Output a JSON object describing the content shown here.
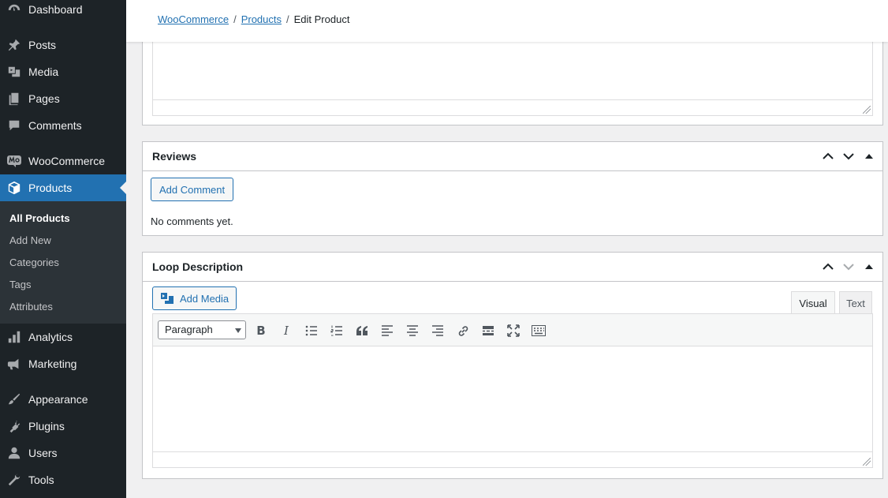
{
  "sidebar": {
    "items": [
      {
        "label": "Dashboard",
        "icon": "dashboard-icon"
      },
      {
        "label": "Posts",
        "icon": "pin-icon"
      },
      {
        "label": "Media",
        "icon": "media-icon"
      },
      {
        "label": "Pages",
        "icon": "pages-icon"
      },
      {
        "label": "Comments",
        "icon": "comments-icon"
      },
      {
        "label": "WooCommerce",
        "icon": "woocommerce-icon"
      },
      {
        "label": "Products",
        "icon": "products-box-icon"
      },
      {
        "label": "Analytics",
        "icon": "analytics-icon"
      },
      {
        "label": "Marketing",
        "icon": "megaphone-icon"
      },
      {
        "label": "Appearance",
        "icon": "paintbrush-icon"
      },
      {
        "label": "Plugins",
        "icon": "plugin-icon"
      },
      {
        "label": "Users",
        "icon": "user-icon"
      },
      {
        "label": "Tools",
        "icon": "wrench-icon"
      }
    ],
    "submenu": [
      "All Products",
      "Add New",
      "Categories",
      "Tags",
      "Attributes"
    ]
  },
  "breadcrumb": {
    "first": "WooCommerce",
    "second": "Products",
    "current": "Edit Product",
    "separator": "/"
  },
  "reviews": {
    "title": "Reviews",
    "add_button": "Add Comment",
    "empty_text": "No comments yet."
  },
  "loop_description": {
    "title": "Loop Description",
    "add_media": "Add Media",
    "tab_visual": "Visual",
    "tab_text": "Text",
    "format_value": "Paragraph"
  },
  "colors": {
    "sidebar_bg": "#1d2327",
    "accent": "#2271b1",
    "page_bg": "#f0f0f1"
  }
}
